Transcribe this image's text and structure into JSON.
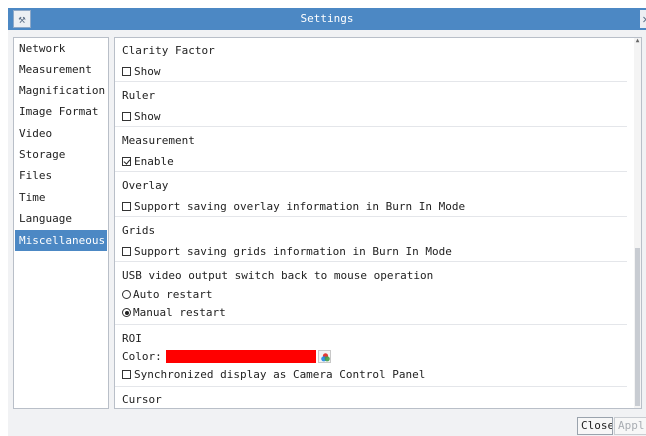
{
  "window": {
    "title": "Settings"
  },
  "sidebar": {
    "items": [
      {
        "label": "Network"
      },
      {
        "label": "Measurement"
      },
      {
        "label": "Magnification"
      },
      {
        "label": "Image Format"
      },
      {
        "label": "Video"
      },
      {
        "label": "Storage"
      },
      {
        "label": "Files"
      },
      {
        "label": "Time"
      },
      {
        "label": "Language"
      },
      {
        "label": "Miscellaneous",
        "selected": true
      }
    ]
  },
  "content": {
    "clarity": {
      "title": "Clarity Factor",
      "option": "Show",
      "checked": false
    },
    "ruler": {
      "title": "Ruler",
      "option": "Show",
      "checked": false
    },
    "measurement": {
      "title": "Measurement",
      "option": "Enable",
      "checked": true
    },
    "overlay": {
      "title": "Overlay",
      "option": "Support saving overlay information in Burn In Mode",
      "checked": false
    },
    "grids": {
      "title": "Grids",
      "option": "Support saving grids information in Burn In Mode",
      "checked": false
    },
    "usb": {
      "title": "USB video output switch back to mouse operation",
      "options": [
        {
          "label": "Auto restart",
          "selected": false
        },
        {
          "label": "Manual restart",
          "selected": true
        }
      ]
    },
    "roi": {
      "title": "ROI",
      "color_label": "Color:",
      "color": "#ff0000",
      "sync_option": "Synchronized display as Camera Control Panel",
      "sync_checked": false
    },
    "cursor": {
      "title": "Cursor"
    }
  },
  "footer": {
    "close_label": "Close",
    "apply_label": "Appl"
  },
  "icons": {
    "app": "tool-icon",
    "close": "close-icon",
    "palette": "color-palette-icon"
  },
  "colors": {
    "accent": "#4c88c4",
    "roi": "#ff0000"
  }
}
